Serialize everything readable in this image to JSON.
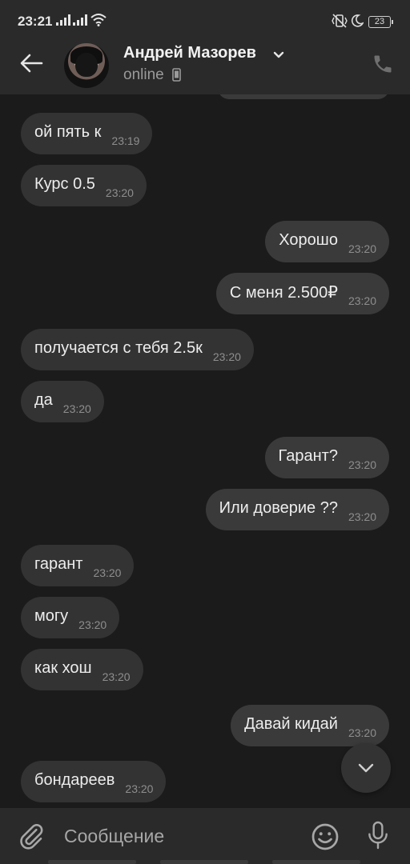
{
  "status_bar": {
    "time": "23:21",
    "battery": "23",
    "icons": [
      "signal-icon",
      "signal-icon",
      "wifi-icon",
      "vibrate-icon",
      "moon-icon",
      "battery-icon"
    ]
  },
  "header": {
    "name": "Андрей Мазорев",
    "status": "online",
    "icons": [
      "back-arrow-icon",
      "avatar",
      "chevron-down-icon",
      "mobile-device-icon",
      "phone-icon"
    ]
  },
  "messages": [
    {
      "dir": "in",
      "text": "ой пять к",
      "time": "23:19"
    },
    {
      "dir": "in",
      "text": "Курс 0.5",
      "time": "23:20"
    },
    {
      "dir": "out",
      "text": "Хорошо",
      "time": "23:20"
    },
    {
      "dir": "out",
      "text": "С меня 2.500₽",
      "time": "23:20"
    },
    {
      "dir": "in",
      "text": "получается с тебя 2.5к",
      "time": "23:20"
    },
    {
      "dir": "in",
      "text": "да",
      "time": "23:20"
    },
    {
      "dir": "out",
      "text": "Гарант?",
      "time": "23:20"
    },
    {
      "dir": "out",
      "text": "Или доверие ??",
      "time": "23:20"
    },
    {
      "dir": "in",
      "text": "гарант",
      "time": "23:20"
    },
    {
      "dir": "in",
      "text": "могу",
      "time": "23:20"
    },
    {
      "dir": "in",
      "text": "как хош",
      "time": "23:20"
    },
    {
      "dir": "out",
      "text": "Давай кидай",
      "time": "23:20"
    },
    {
      "dir": "in",
      "text": "бондареев",
      "time": "23:20"
    }
  ],
  "composer": {
    "placeholder": "Сообщение",
    "icons": [
      "paperclip-icon",
      "emoji-icon",
      "microphone-icon"
    ]
  },
  "colors": {
    "background": "#1b1b1b",
    "bar": "#2a2a2a",
    "incoming_bubble": "#333333",
    "outgoing_bubble": "#3a3a3a",
    "text": "#ededed",
    "muted": "#8e8e8e"
  }
}
